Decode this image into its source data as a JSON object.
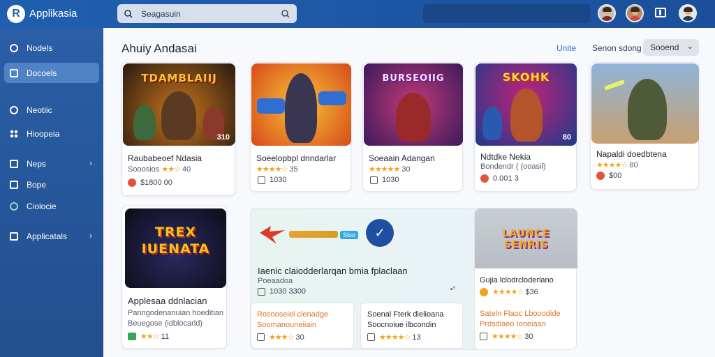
{
  "app": {
    "title": "Applikasia",
    "search_placeholder": "Seagasuin"
  },
  "sidebar": {
    "items": [
      {
        "label": "Nodels"
      },
      {
        "label": "Docoels"
      },
      {
        "label": "Neotiic"
      },
      {
        "label": "Hioopeia"
      },
      {
        "label": "Neps"
      },
      {
        "label": "Bope"
      },
      {
        "label": "Ciolocie"
      },
      {
        "label": "Applicatals"
      }
    ]
  },
  "main": {
    "title": "Ahuiy Andasai",
    "link": "Unite",
    "sort_label": "Senon sdong",
    "sort_value": "Sooend"
  },
  "cards": [
    {
      "art_text": "TDAMBLAIIJ",
      "badge": "310",
      "title": "Raubabeoef Ndasia",
      "sub": "Sooosios",
      "rating": "40",
      "price": "$1800 00",
      "colors": [
        "#2a1a12",
        "#c7761c"
      ]
    },
    {
      "art_text": "",
      "badge": "",
      "title": "Soeelopbpl dnndarlar",
      "sub": "",
      "rating": "35",
      "price": "1030",
      "colors": [
        "#f5a623",
        "#d64b1a"
      ]
    },
    {
      "art_text": "BURSEOIIG",
      "badge": "",
      "title": "Soeaain Adangan",
      "sub": "",
      "rating": "30",
      "price": "1030",
      "colors": [
        "#3b1a5a",
        "#c33a7a"
      ]
    },
    {
      "art_text": "SKOHK",
      "badge": "80",
      "title": "Ndtdke Nekia",
      "sub": "Bondendr ( (ooasil)",
      "rating": "",
      "price": "0.001 3",
      "colors": [
        "#1e3a8a",
        "#c2227a"
      ]
    },
    {
      "art_text": "",
      "badge": "",
      "title": "Napaldi doedbtena",
      "sub": "",
      "rating": "80",
      "price": "$00",
      "colors": [
        "#8fb4d8",
        "#c8a070"
      ]
    }
  ],
  "featured": {
    "art_text": "TREX IUENATA",
    "title": "Applesaa ddnlacian",
    "desc_line1": "Panngodenanuian hoeditian",
    "desc_line2": "Beuegose (idblocarld)",
    "rating": "11"
  },
  "banner": {
    "tag": "Sloo",
    "title": "Iaenic claiodderlarqan bmia fplaclaan",
    "subtitle": "Poeaadoa",
    "count": "1030 3300",
    "sub_items": [
      {
        "line1": "Rosooseiel clenadge",
        "line2": "Soomanouneiiain",
        "rating": "30",
        "orange": true
      },
      {
        "line1": "Soenal Fterk dielioana",
        "line2": "Soocnoiue ilbcondin",
        "rating": "13",
        "orange": false
      },
      {
        "line1": "Sateln Flaoc Lbooodide",
        "line2": "Prdsdiaeo Ioneiaan",
        "rating": "30",
        "orange": true
      }
    ],
    "side_card": {
      "art_text": "LAUNCE SENRIS",
      "title": "Gujia lclodrcloderlano",
      "rating": "$36"
    }
  }
}
